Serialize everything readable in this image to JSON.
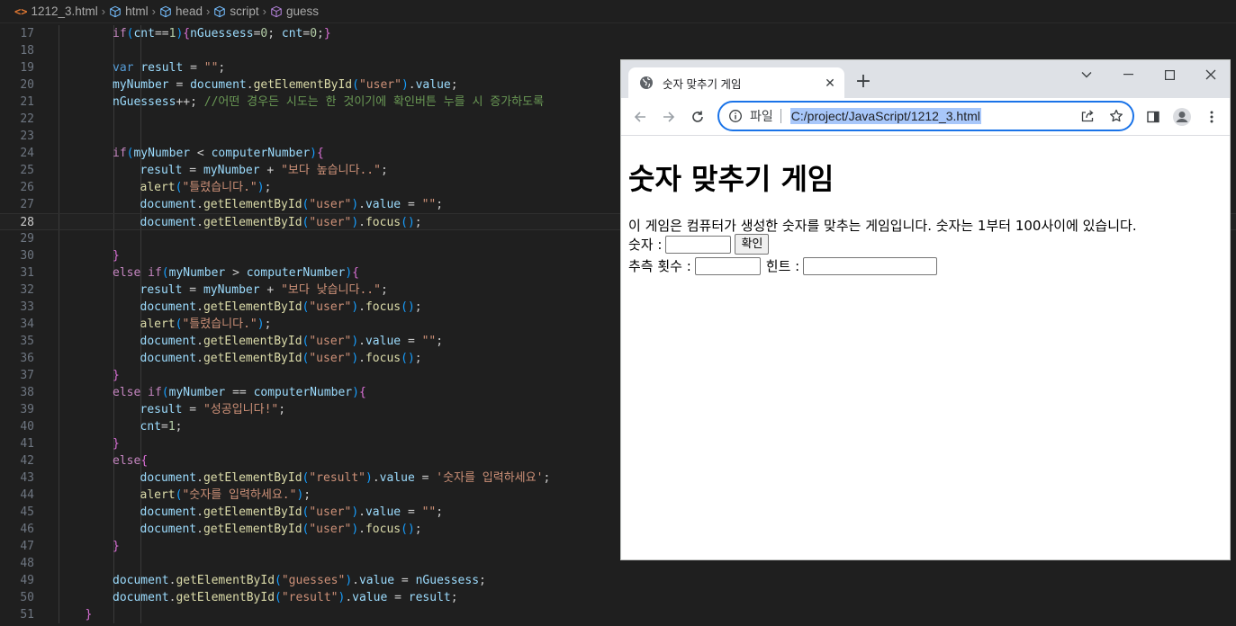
{
  "breadcrumb": {
    "file": "1212_3.html",
    "items": [
      "html",
      "head",
      "script",
      "guess"
    ]
  },
  "editor": {
    "active_line": "28",
    "lines": [
      {
        "n": "17",
        "text": "if(cnt==1){nGuessess=0; cnt=0;}"
      },
      {
        "n": "18",
        "text": ""
      },
      {
        "n": "19",
        "text": "var result = \"\";"
      },
      {
        "n": "20",
        "text": "myNumber = document.getElementById(\"user\").value;"
      },
      {
        "n": "21",
        "text": "nGuessess++; //어떤 경우든 시도는 한 것이기에 확인버튼 누를 시 증가하도록"
      },
      {
        "n": "22",
        "text": ""
      },
      {
        "n": "23",
        "text": ""
      },
      {
        "n": "24",
        "text": "if(myNumber < computerNumber){"
      },
      {
        "n": "25",
        "text": "result = myNumber + \"보다 높습니다..\";"
      },
      {
        "n": "26",
        "text": "alert(\"틀렸습니다.\");"
      },
      {
        "n": "27",
        "text": "document.getElementById(\"user\").value = \"\";"
      },
      {
        "n": "28",
        "text": "document.getElementById(\"user\").focus();"
      },
      {
        "n": "29",
        "text": ""
      },
      {
        "n": "30",
        "text": "}"
      },
      {
        "n": "31",
        "text": "else if(myNumber > computerNumber){"
      },
      {
        "n": "32",
        "text": "result = myNumber + \"보다 낮습니다..\";"
      },
      {
        "n": "33",
        "text": "document.getElementById(\"user\").focus();"
      },
      {
        "n": "34",
        "text": "alert(\"틀렸습니다.\");"
      },
      {
        "n": "35",
        "text": "document.getElementById(\"user\").value = \"\";"
      },
      {
        "n": "36",
        "text": "document.getElementById(\"user\").focus();"
      },
      {
        "n": "37",
        "text": "}"
      },
      {
        "n": "38",
        "text": "else if(myNumber == computerNumber){"
      },
      {
        "n": "39",
        "text": "result = \"성공입니다!\";"
      },
      {
        "n": "40",
        "text": "cnt=1;"
      },
      {
        "n": "41",
        "text": "}"
      },
      {
        "n": "42",
        "text": "else{"
      },
      {
        "n": "43",
        "text": "document.getElementById(\"result\").value = '숫자를 입력하세요';"
      },
      {
        "n": "44",
        "text": "alert(\"숫자를 입력하세요.\");"
      },
      {
        "n": "45",
        "text": "document.getElementById(\"user\").value = \"\";"
      },
      {
        "n": "46",
        "text": "document.getElementById(\"user\").focus();"
      },
      {
        "n": "47",
        "text": "}"
      },
      {
        "n": "48",
        "text": ""
      },
      {
        "n": "49",
        "text": "document.getElementById(\"guesses\").value = nGuessess;"
      },
      {
        "n": "50",
        "text": "document.getElementById(\"result\").value = result;"
      },
      {
        "n": "51",
        "text": "}"
      }
    ]
  },
  "browser": {
    "tab_title": "숫자 맞추기 게임",
    "new_tab": "+",
    "scheme_label": "파일",
    "url": "C:/project/JavaScript/1212_3.html",
    "page": {
      "heading": "숫자 맞추기 게임",
      "description": "이 게임은 컴퓨터가 생성한 숫자를 맞추는 게임입니다. 숫자는 1부터 100사이에 있습니다.",
      "number_label": "숫자 :",
      "confirm_button": "확인",
      "guesses_label": "추측 횟수 :",
      "hint_label": "힌트 :"
    }
  },
  "colors": {
    "editor_bg": "#1f1f1f",
    "keyword": "#569cd6",
    "string": "#ce9178",
    "comment": "#6a9955",
    "omnibox_focus": "#1a73e8"
  }
}
